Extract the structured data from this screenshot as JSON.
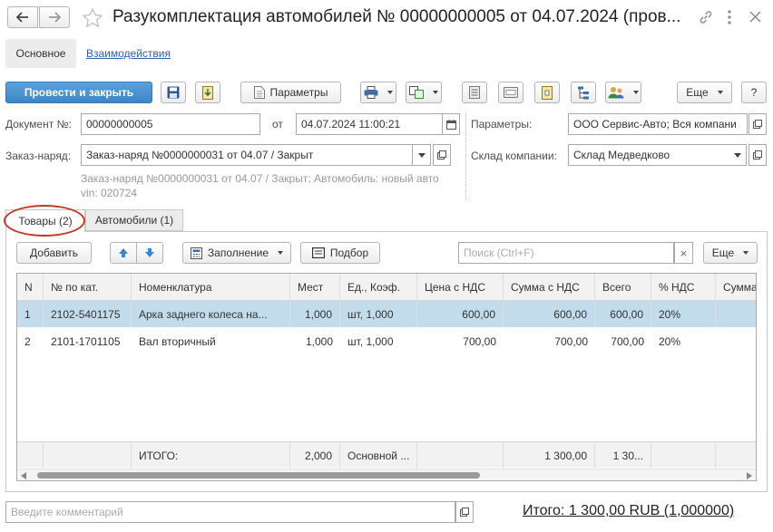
{
  "window": {
    "title": "Разукомплектация автомобилей № 00000000005 от 04.07.2024 (пров..."
  },
  "nav_tabs": {
    "main": "Основное",
    "interactions": "Взаимодействия"
  },
  "toolbar": {
    "post_close": "Провести и закрыть",
    "params": "Параметры",
    "more": "Еще",
    "help": "?"
  },
  "form": {
    "doc_no_label": "Документ №:",
    "doc_no": "00000000005",
    "date_label": "от",
    "date": "04.07.2024 11:00:21",
    "params_label": "Параметры:",
    "params": "ООО Сервис-Авто; Вся компани",
    "order_label": "Заказ-наряд:",
    "order": "Заказ-наряд №0000000031  от 04.07 / Закрыт",
    "order_hint": "Заказ-наряд №0000000031  от 04.07 / Закрыт; Автомобиль: новый авто vin: 020724",
    "warehouse_label": "Склад компании:",
    "warehouse": "Склад Медведково"
  },
  "tabs": [
    "Товары (2)",
    "Автомобили (1)"
  ],
  "table_toolbar": {
    "add": "Добавить",
    "fill": "Заполнение",
    "pick": "Подбор",
    "search_placeholder": "Поиск (Ctrl+F)",
    "clear": "×",
    "more": "Еще"
  },
  "table": {
    "columns": [
      "N",
      "№ по кат.",
      "Номенклатура",
      "Мест",
      "Ед., Коэф.",
      "Цена с НДС",
      "Сумма с НДС",
      "Всего",
      "% НДС",
      "Сумма"
    ],
    "rows": [
      [
        "1",
        "2102-5401175",
        "Арка заднего колеса на...",
        "1,000",
        "шт, 1,000",
        "600,00",
        "600,00",
        "600,00",
        "20%",
        ""
      ],
      [
        "2",
        "2101-1701105",
        "Вал вторичный",
        "1,000",
        "шт, 1,000",
        "700,00",
        "700,00",
        "700,00",
        "20%",
        ""
      ]
    ],
    "selected_row": 0,
    "footer": [
      "",
      "",
      "ИТОГО:",
      "2,000",
      "Основной ...",
      "",
      "1 300,00",
      "1 30...",
      "",
      ""
    ]
  },
  "comment_placeholder": "Введите комментарий",
  "total": "Итого: 1 300,00 RUB (1,000000)",
  "colors": {
    "accent": "#4a90cf",
    "selected_row": "#c2dcec",
    "highlight": "#c0392b"
  }
}
